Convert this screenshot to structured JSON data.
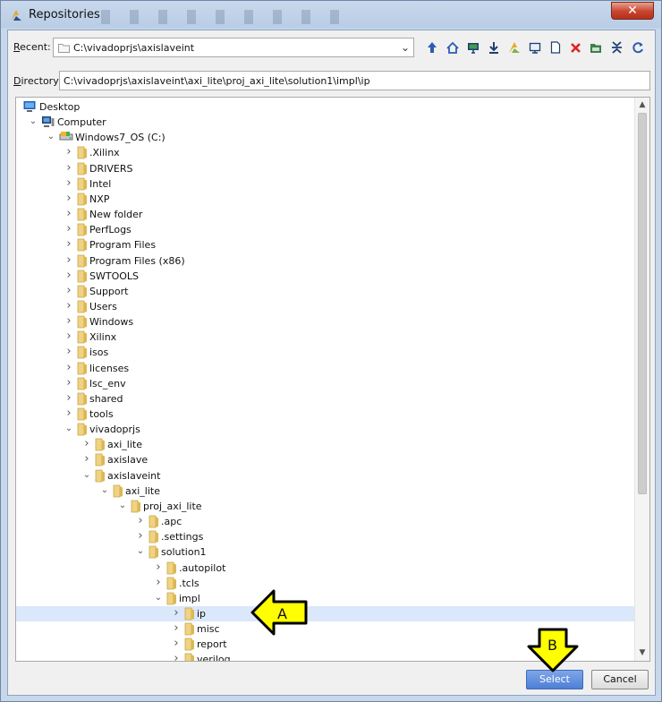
{
  "window": {
    "title": "Repositories",
    "close_glyph": "✕"
  },
  "recent": {
    "label_prefix": "R",
    "label_rest": "ecent:",
    "value": "C:\\vivadoprjs\\axislaveint"
  },
  "toolbar": {
    "icons": [
      "up-arrow-icon",
      "home-icon",
      "desktop-icon",
      "download-icon",
      "vivado-logo-icon",
      "computer-icon",
      "new-file-icon",
      "delete-icon",
      "new-folder-icon",
      "collapse-icon",
      "refresh-icon"
    ]
  },
  "directory": {
    "label_prefix": "D",
    "label_rest": "irectory:",
    "value": "C:\\vivadoprjs\\axislaveint\\axi_lite\\proj_axi_lite\\solution1\\impl\\ip"
  },
  "tree": [
    {
      "label": "Desktop",
      "depth": 0,
      "expanded": null,
      "icon": "desktop"
    },
    {
      "label": "Computer",
      "depth": 1,
      "expanded": true,
      "icon": "computer"
    },
    {
      "label": "Windows7_OS (C:)",
      "depth": 2,
      "expanded": true,
      "icon": "drive"
    },
    {
      "label": ".Xilinx",
      "depth": 3,
      "expanded": false,
      "icon": "folder"
    },
    {
      "label": "DRIVERS",
      "depth": 3,
      "expanded": false,
      "icon": "folder"
    },
    {
      "label": "Intel",
      "depth": 3,
      "expanded": false,
      "icon": "folder"
    },
    {
      "label": "NXP",
      "depth": 3,
      "expanded": false,
      "icon": "folder"
    },
    {
      "label": "New folder",
      "depth": 3,
      "expanded": false,
      "icon": "folder"
    },
    {
      "label": "PerfLogs",
      "depth": 3,
      "expanded": false,
      "icon": "folder"
    },
    {
      "label": "Program Files",
      "depth": 3,
      "expanded": false,
      "icon": "folder"
    },
    {
      "label": "Program Files (x86)",
      "depth": 3,
      "expanded": false,
      "icon": "folder"
    },
    {
      "label": "SWTOOLS",
      "depth": 3,
      "expanded": false,
      "icon": "folder"
    },
    {
      "label": "Support",
      "depth": 3,
      "expanded": false,
      "icon": "folder"
    },
    {
      "label": "Users",
      "depth": 3,
      "expanded": false,
      "icon": "folder"
    },
    {
      "label": "Windows",
      "depth": 3,
      "expanded": false,
      "icon": "folder"
    },
    {
      "label": "Xilinx",
      "depth": 3,
      "expanded": false,
      "icon": "folder"
    },
    {
      "label": "isos",
      "depth": 3,
      "expanded": false,
      "icon": "folder"
    },
    {
      "label": "licenses",
      "depth": 3,
      "expanded": false,
      "icon": "folder"
    },
    {
      "label": "lsc_env",
      "depth": 3,
      "expanded": false,
      "icon": "folder"
    },
    {
      "label": "shared",
      "depth": 3,
      "expanded": false,
      "icon": "folder"
    },
    {
      "label": "tools",
      "depth": 3,
      "expanded": false,
      "icon": "folder"
    },
    {
      "label": "vivadoprjs",
      "depth": 3,
      "expanded": true,
      "icon": "folder"
    },
    {
      "label": "axi_lite",
      "depth": 4,
      "expanded": false,
      "icon": "folder"
    },
    {
      "label": "axislave",
      "depth": 4,
      "expanded": false,
      "icon": "folder"
    },
    {
      "label": "axislaveint",
      "depth": 4,
      "expanded": true,
      "icon": "folder"
    },
    {
      "label": "axi_lite",
      "depth": 5,
      "expanded": true,
      "icon": "folder"
    },
    {
      "label": "proj_axi_lite",
      "depth": 6,
      "expanded": true,
      "icon": "folder"
    },
    {
      "label": ".apc",
      "depth": 7,
      "expanded": false,
      "icon": "folder"
    },
    {
      "label": ".settings",
      "depth": 7,
      "expanded": false,
      "icon": "folder"
    },
    {
      "label": "solution1",
      "depth": 7,
      "expanded": true,
      "icon": "folder"
    },
    {
      "label": ".autopilot",
      "depth": 8,
      "expanded": false,
      "icon": "folder"
    },
    {
      "label": ".tcls",
      "depth": 8,
      "expanded": false,
      "icon": "folder"
    },
    {
      "label": "impl",
      "depth": 8,
      "expanded": true,
      "icon": "folder"
    },
    {
      "label": "ip",
      "depth": 9,
      "expanded": false,
      "icon": "folder",
      "selected": true
    },
    {
      "label": "misc",
      "depth": 9,
      "expanded": false,
      "icon": "folder"
    },
    {
      "label": "report",
      "depth": 9,
      "expanded": false,
      "icon": "folder"
    },
    {
      "label": "verilog",
      "depth": 9,
      "expanded": false,
      "icon": "folder"
    }
  ],
  "buttons": {
    "select": "Select",
    "cancel": "Cancel"
  },
  "callouts": {
    "a": "A",
    "b": "B"
  },
  "colors": {
    "selection": "#dbe7fa",
    "select_button": "#4d7fd6",
    "callout_fill": "#ffff00"
  }
}
